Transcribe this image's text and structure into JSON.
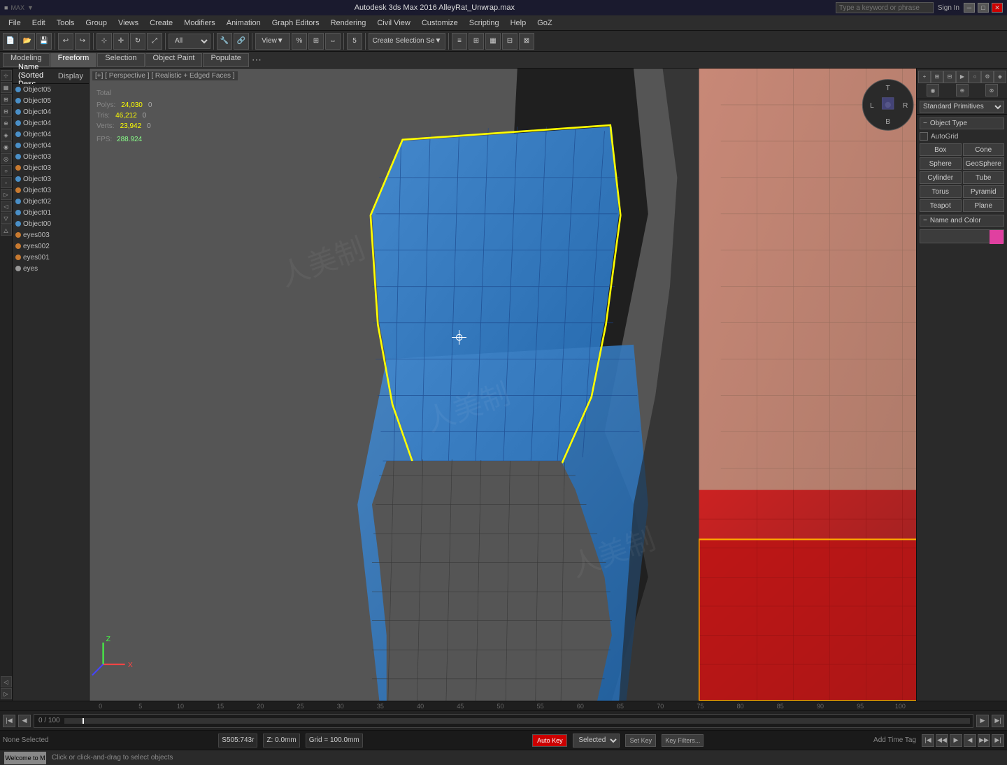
{
  "titlebar": {
    "left": "MAX",
    "title": "Autodesk 3ds Max 2016   AlleyRat_Unwrap.max",
    "search_placeholder": "Type a keyword or phrase",
    "signin": "Sign In",
    "close": "✕",
    "minimize": "─",
    "maximize": "□"
  },
  "menu": {
    "items": [
      "File",
      "Edit",
      "Tools",
      "Group",
      "Views",
      "Create",
      "Modifiers",
      "Animation",
      "Graph Editors",
      "Rendering",
      "Civil View",
      "Customize",
      "Scripting",
      "Help",
      "GoZ"
    ]
  },
  "mode_bar": {
    "tabs": [
      "Modeling",
      "Freeform",
      "Selection",
      "Object Paint",
      "Populate"
    ]
  },
  "scene_header": {
    "tabs": [
      "Name (Sorted Desc",
      "Display"
    ]
  },
  "scene_objects": [
    {
      "name": "Object05",
      "color": "blue"
    },
    {
      "name": "Object05",
      "color": "blue"
    },
    {
      "name": "Object04",
      "color": "blue"
    },
    {
      "name": "Object04",
      "color": "blue"
    },
    {
      "name": "Object04",
      "color": "blue"
    },
    {
      "name": "Object04",
      "color": "blue"
    },
    {
      "name": "Object03",
      "color": "blue"
    },
    {
      "name": "Object03",
      "color": "orange"
    },
    {
      "name": "Object03",
      "color": "blue"
    },
    {
      "name": "Object03",
      "color": "orange"
    },
    {
      "name": "Object02",
      "color": "blue"
    },
    {
      "name": "Object01",
      "color": "blue"
    },
    {
      "name": "Object00",
      "color": "blue"
    },
    {
      "name": "eyes003",
      "color": "orange"
    },
    {
      "name": "eyes002",
      "color": "orange"
    },
    {
      "name": "eyes001",
      "color": "orange"
    },
    {
      "name": "eyes",
      "color": "white"
    }
  ],
  "stats": {
    "header": "Total",
    "polys_label": "Polys:",
    "polys_val": "24,030",
    "polys_zero": "0",
    "tris_label": "Tris:",
    "tris_val": "46,212",
    "tris_zero": "0",
    "verts_label": "Verts:",
    "verts_val": "23,942",
    "verts_zero": "0",
    "fps_label": "FPS:",
    "fps_val": "288.924"
  },
  "viewport_label": "[+] [ Perspective ] [ Realistic + Edged Faces ]",
  "right_panel": {
    "dropdown": "Standard Primitives",
    "object_type_title": "Object Type",
    "autogrid_label": "AutoGrid",
    "buttons": [
      "Box",
      "Cone",
      "Sphere",
      "GeoSphere",
      "Cylinder",
      "Tube",
      "Torus",
      "Pyramid",
      "Teapot",
      "Plane"
    ],
    "name_color_title": "Name and Color"
  },
  "timeline": {
    "counter": "0 / 100",
    "labels": [
      "0",
      "5",
      "10",
      "15",
      "20",
      "25",
      "30",
      "35",
      "40",
      "45",
      "50",
      "55",
      "60",
      "65",
      "70",
      "75",
      "80",
      "85",
      "90",
      "95",
      "100"
    ]
  },
  "status_bar": {
    "none_selected": "None Selected",
    "coords": "S505:743r",
    "z_val": "Z: 0.0mm",
    "grid": "Grid = 100.0mm",
    "auto_key": "Auto Key",
    "selected": "Selected",
    "set_key": "Set Key",
    "key_filters": "Key Filters...",
    "add_time_tag": "Add Time Tag",
    "welcome": "Welcome to M"
  },
  "action_bar": {
    "message": "Click or click-and-drag to select objects"
  }
}
